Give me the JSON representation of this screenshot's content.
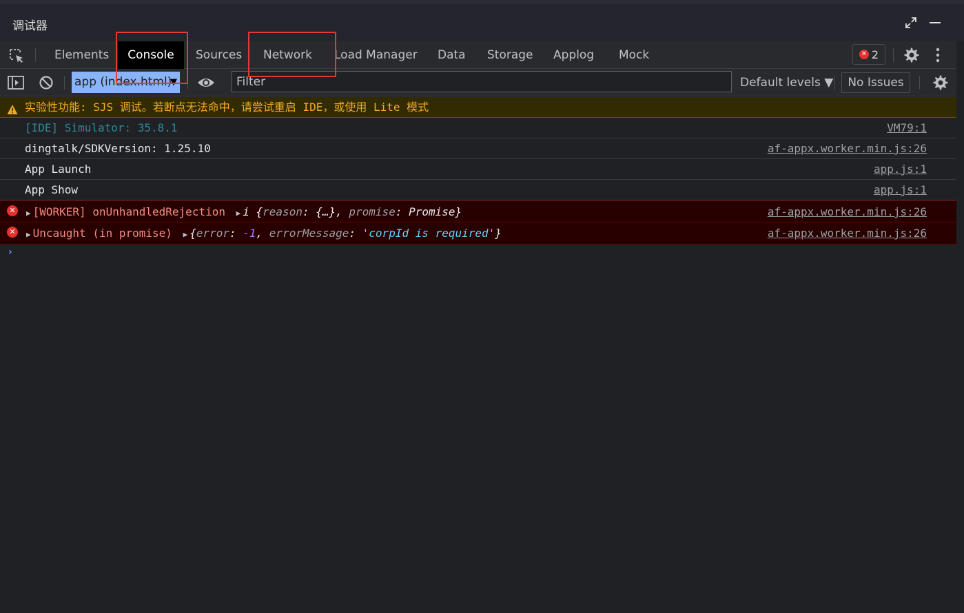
{
  "window": {
    "title": "调试器",
    "expand_icon": "expand-arrows-icon",
    "minimize_icon": "minimize-icon"
  },
  "tabs": [
    {
      "label": "Elements"
    },
    {
      "label": "Console",
      "active": true
    },
    {
      "label": "Sources"
    },
    {
      "label": "Network"
    },
    {
      "label": "Load Manager"
    },
    {
      "label": "Data"
    },
    {
      "label": "Storage"
    },
    {
      "label": "Applog"
    },
    {
      "label": "Mock"
    }
  ],
  "tabbar": {
    "error_count": "2"
  },
  "toolbar": {
    "context": "app (index.html)",
    "filter_placeholder": "Filter",
    "levels": "Default levels ▼",
    "issues": "No Issues"
  },
  "console": {
    "warning": "实验性功能: SJS 调试。若断点无法命中，请尝试重启 IDE，或使用 Lite 模式",
    "logs": [
      {
        "text": "[IDE] Simulator: 35.8.1",
        "source": "VM79:1"
      },
      {
        "text": "dingtalk/SDKVersion: 1.25.10",
        "source": "af-appx.worker.min.js:26"
      },
      {
        "text": "App Launch",
        "source": "app.js:1"
      },
      {
        "text": "App Show",
        "source": "app.js:1"
      }
    ],
    "errors": [
      {
        "prefix": "[WORKER] onUnhandledRejection",
        "i": "i",
        "k1": "reason",
        "v1": "{…}",
        "k2": "promise",
        "v2": "Promise",
        "source": "af-appx.worker.min.js:26"
      },
      {
        "prefix": "Uncaught (in promise)",
        "k1": "error",
        "v1": "-1",
        "k2": "errorMessage",
        "v2": "'corpId is required'",
        "source": "af-appx.worker.min.js:26"
      }
    ]
  },
  "colors": {
    "background": "#202124",
    "active_tab": "#000000",
    "context_select": "#8ab4f8",
    "warning_text": "#f2ab26",
    "error_text": "#f28b82",
    "highlight_box": "#e53935"
  }
}
